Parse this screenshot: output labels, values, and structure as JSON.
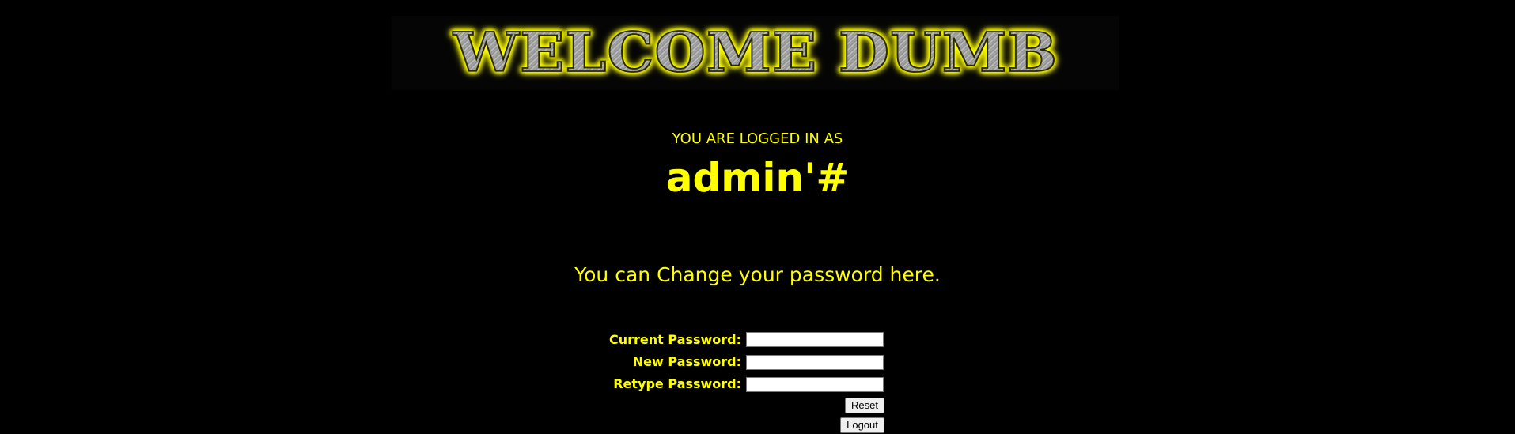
{
  "banner": {
    "text": "WELCOME DUMB"
  },
  "session": {
    "label": "YOU ARE LOGGED IN AS",
    "username": "admin'#"
  },
  "message": "You can Change your password here.",
  "form": {
    "current_password_label": "Current Password:",
    "current_password_value": "",
    "new_password_label": "New Password:",
    "new_password_value": "",
    "retype_password_label": "Retype Password:",
    "retype_password_value": "",
    "reset_label": "Reset",
    "logout_label": "Logout"
  },
  "colors": {
    "background": "#000000",
    "text": "#ffff00"
  }
}
